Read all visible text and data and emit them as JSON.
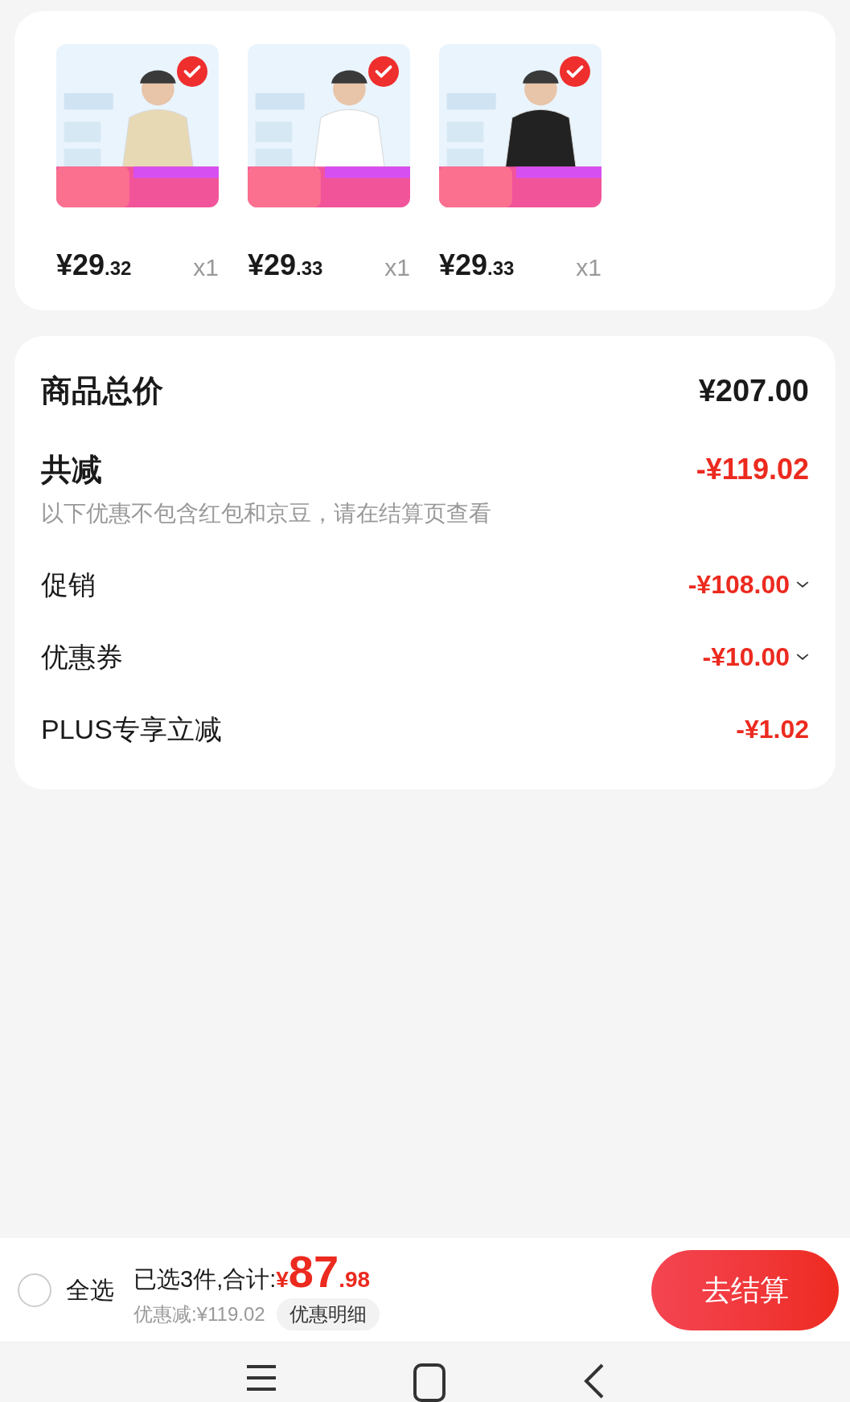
{
  "products": [
    {
      "selected": true,
      "price_main": "¥29",
      "price_cents": ".32",
      "quantity": "x1"
    },
    {
      "selected": true,
      "price_main": "¥29",
      "price_cents": ".33",
      "quantity": "x1"
    },
    {
      "selected": true,
      "price_main": "¥29",
      "price_cents": ".33",
      "quantity": "x1"
    }
  ],
  "summary": {
    "total": {
      "label": "商品总价",
      "value": "¥207.00"
    },
    "reduction": {
      "label": "共减",
      "value": "-¥119.02",
      "note": "以下优惠不包含红包和京豆，请在结算页查看"
    },
    "items": [
      {
        "label": "促销",
        "value": "-¥108.00",
        "expandable": true
      },
      {
        "label": "优惠券",
        "value": "-¥10.00",
        "expandable": true
      },
      {
        "label": "PLUS专享立减",
        "value": "-¥1.02",
        "expandable": false
      }
    ]
  },
  "checkout_bar": {
    "select_all": {
      "label": "全选",
      "checked": false
    },
    "selected_count": "已选3件,合计:",
    "currency": "¥",
    "total_main": "87",
    "total_cents": ".98",
    "discount": "优惠减:¥119.02",
    "details_button": "优惠明细",
    "checkout_button": "去结算"
  }
}
